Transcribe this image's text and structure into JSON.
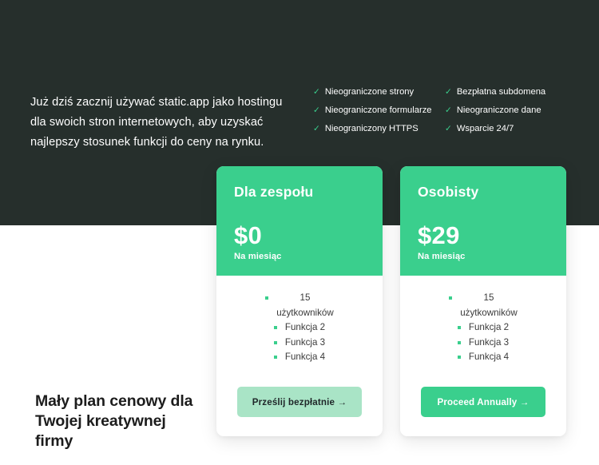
{
  "hero": {
    "intro_paragraph": "Już dziś zacznij używać static.app jako hostingu dla swoich stron internetowych, aby uzyskać najlepszy stosunek funkcji do ceny na rynku.",
    "check_icon": "check-icon",
    "features": [
      "Nieograniczone strony",
      "Bezpłatna subdomena",
      "Nieograniczone formularze",
      "Nieograniczone dane",
      "Nieograniczony HTTPS",
      "Wsparcie 24/7"
    ]
  },
  "pricing": {
    "cards": [
      {
        "name": "Dla zespołu",
        "price": "$0",
        "period": "Na miesiąc",
        "features": [
          "15 użytkowników",
          "Funkcja 2",
          "Funkcja 3",
          "Funkcja 4"
        ],
        "cta_label": "Prześlij bezpłatnie →",
        "cta_style": "light"
      },
      {
        "name": "Osobisty",
        "price": "$29",
        "period": "Na miesiąc",
        "features": [
          "15 użytkowników",
          "Funkcja 2",
          "Funkcja 3",
          "Funkcja 4"
        ],
        "cta_label": "Proceed Annually →",
        "cta_style": "solid"
      }
    ]
  },
  "footer": {
    "heading": "Mały plan cenowy dla Twojej kreatywnej firmy"
  },
  "colors": {
    "dark_band": "#262F2C",
    "accent_green": "#3ACF8D",
    "cta_light": "#A9E4C6",
    "page_background": "#FFFFFF",
    "heading_text": "#1C1C1C"
  }
}
